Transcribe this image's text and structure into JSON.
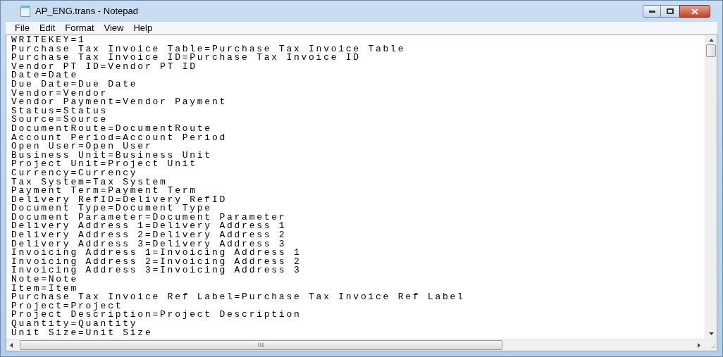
{
  "window": {
    "title": "AP_ENG.trans - Notepad"
  },
  "menu": [
    "File",
    "Edit",
    "Format",
    "View",
    "Help"
  ],
  "lines": [
    "WRITEKEY=1",
    "Purchase Tax Invoice Table=Purchase Tax Invoice Table",
    "Purchase Tax Invoice ID=Purchase Tax Invoice ID",
    "Vendor PT ID=Vendor PT ID",
    "Date=Date",
    "Due Date=Due Date",
    "Vendor=Vendor",
    "Vendor Payment=Vendor Payment",
    "Status=Status",
    "Source=Source",
    "DocumentRoute=DocumentRoute",
    "Account Period=Account Period",
    "Open User=Open User",
    "Business Unit=Business Unit",
    "Project Unit=Project Unit",
    "Currency=Currency",
    "Tax System=Tax System",
    "Payment Term=Payment Term",
    "Delivery RefID=Delivery RefID",
    "Document Type=Document Type",
    "Document Parameter=Document Parameter",
    "Delivery Address 1=Delivery Address 1",
    "Delivery Address 2=Delivery Address 2",
    "Delivery Address 3=Delivery Address 3",
    "Invoicing Address 1=Invoicing Address 1",
    "Invoicing Address 2=Invoicing Address 2",
    "Invoicing Address 3=Invoicing Address 3",
    "Note=Note",
    "Item=Item",
    "Purchase Tax Invoice Ref Label=Purchase Tax Invoice Ref Label",
    "Project=Project",
    "Project Description=Project Description",
    "Quantity=Quantity",
    "Unit Size=Unit Size"
  ]
}
